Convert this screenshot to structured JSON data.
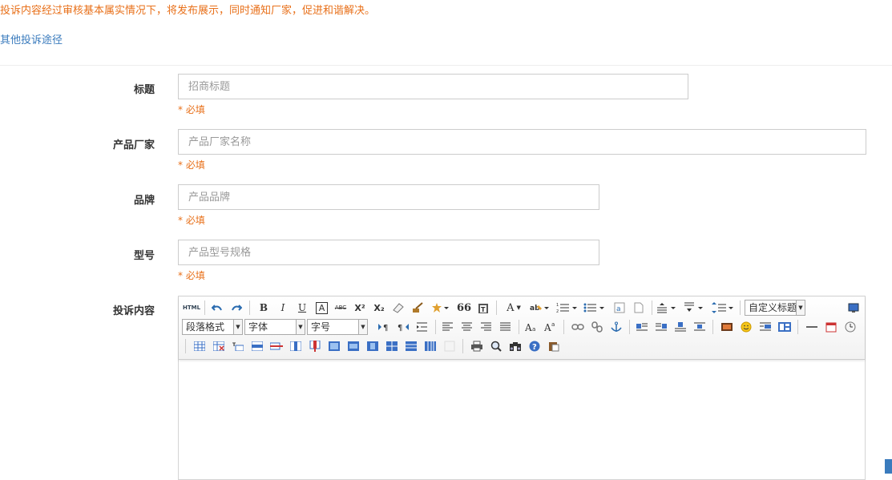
{
  "notice": "投诉内容经过审核基本属实情况下，将发布展示，同时通知厂家，促进和谐解决。",
  "other_link": "其他投诉途径",
  "form": {
    "required_text": "* 必填",
    "title": {
      "label": "标题",
      "placeholder": "招商标题"
    },
    "manufacturer": {
      "label": "产品厂家",
      "placeholder": "产品厂家名称"
    },
    "brand": {
      "label": "品牌",
      "placeholder": "产品品牌"
    },
    "model": {
      "label": "型号",
      "placeholder": "产品型号规格"
    },
    "content": {
      "label": "投诉内容"
    }
  },
  "editor": {
    "html_label": "HTML",
    "bold": "B",
    "italic": "I",
    "underline": "U",
    "font_border": "A",
    "strike": "ABC",
    "superscript": "X²",
    "subscript": "X₂",
    "quote": "66",
    "forecolor": "A",
    "custom_title": "自定义标题",
    "paragraph": "段落格式",
    "font_family": "字体",
    "font_size": "字号"
  },
  "colors": {
    "accent_orange": "#e8701a",
    "link_blue": "#3a7bbd"
  }
}
